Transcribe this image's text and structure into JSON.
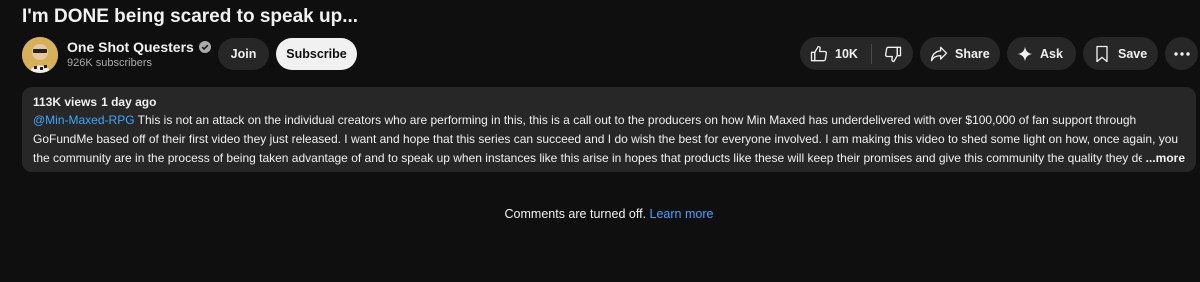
{
  "video": {
    "title": "I'm DONE being scared to speak up..."
  },
  "channel": {
    "name": "One Shot Questers",
    "subscribers": "926K subscribers",
    "verified_icon": "verified-check-icon"
  },
  "buttons": {
    "join": "Join",
    "subscribe": "Subscribe",
    "like_count": "10K",
    "share": "Share",
    "ask": "Ask",
    "save": "Save"
  },
  "icons": {
    "like": "thumbs-up-icon",
    "dislike": "thumbs-down-icon",
    "share": "share-arrow-icon",
    "ask": "sparkle-icon",
    "save": "bookmark-icon",
    "more": "more-horizontal-icon"
  },
  "description": {
    "views": "113K views",
    "date": "1 day ago",
    "mention": "@Min-Maxed-RPG",
    "text": " This is not an attack on the individual creators who are performing in this, this is a call out to the producers on how Min Maxed has underdelivered with over $100,000 of fan support through GoFundMe based off of their first video they just released. I want and hope that this series can succeed and I do wish the best for everyone involved. I am making this video to shed some light on how, once again, you the community are in the process of being taken advantage of and to speak up when instances like this arise in hopes that products like these will keep their promises and give this community the quality they deserve.",
    "more": "...more"
  },
  "comments": {
    "status": "Comments are turned off.",
    "learn_more": "Learn more"
  },
  "colors": {
    "background": "#0f0f0f",
    "surface": "#272727",
    "link": "#3ea6ff",
    "text": "#f1f1f1",
    "secondary_text": "#aaaaaa"
  }
}
